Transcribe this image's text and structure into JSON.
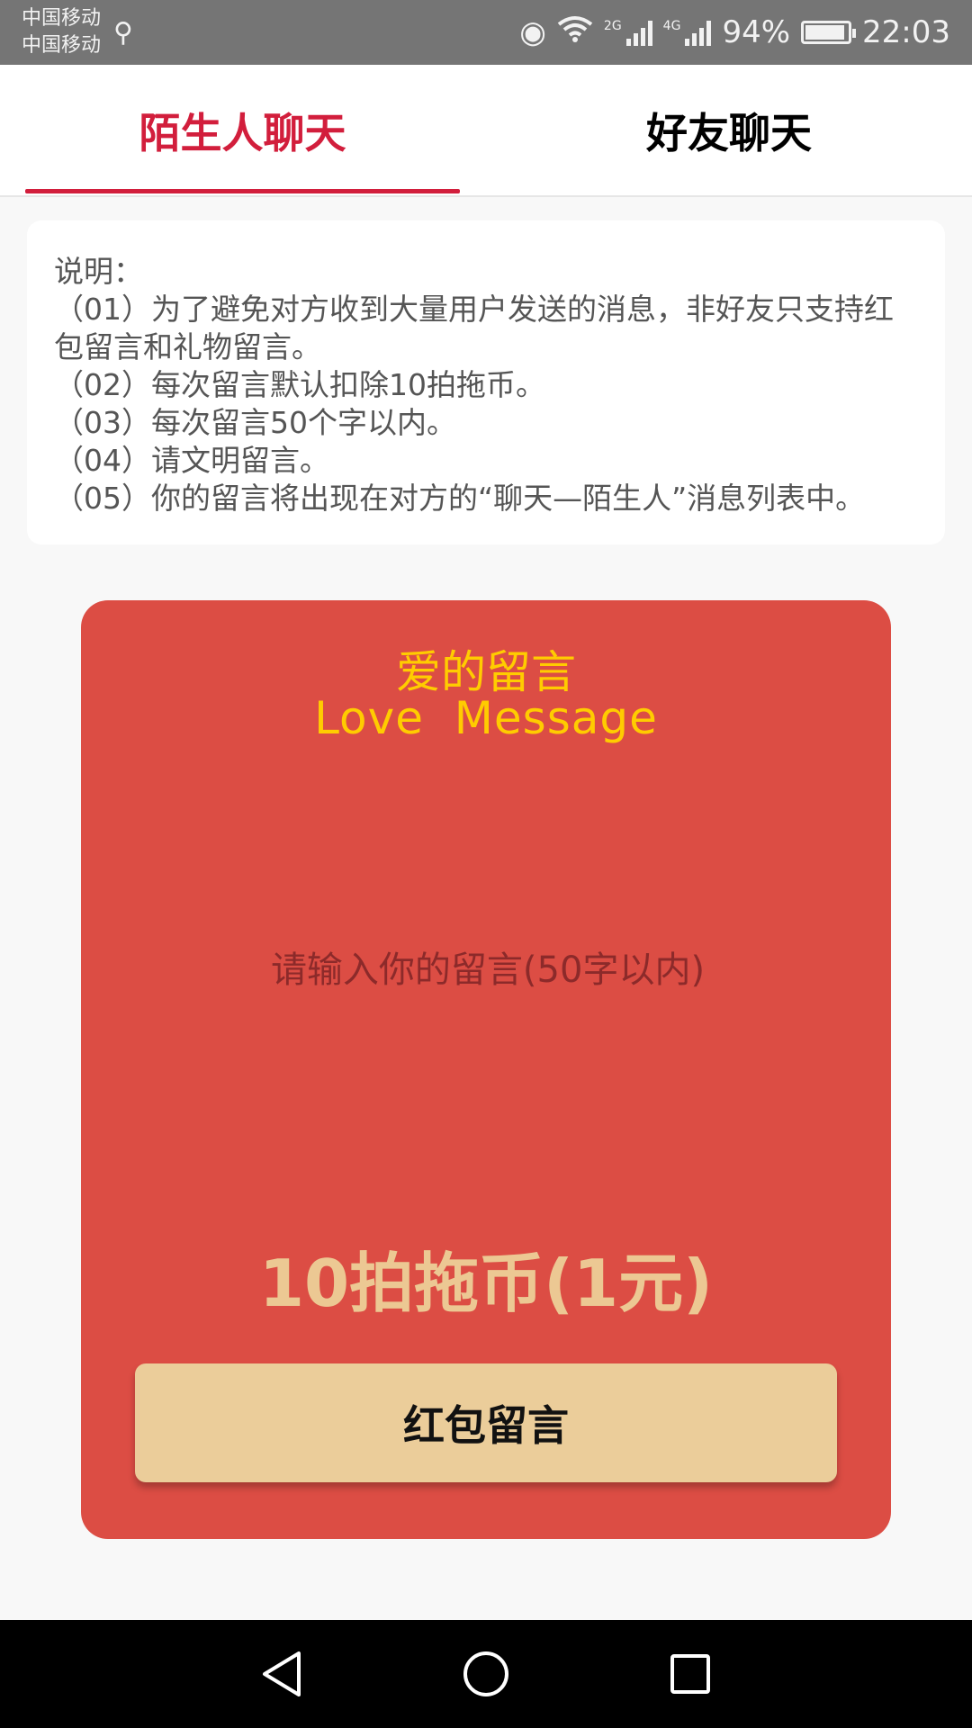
{
  "status_bar": {
    "carrier1": "中国移动",
    "carrier2": "中国移动",
    "usb_icon": "usb-icon",
    "network1": "2G",
    "network2": "4G",
    "battery": "94%",
    "battery_level": 0.94,
    "time": "22:03"
  },
  "tabs": [
    {
      "label": "陌生人聊天",
      "active": true
    },
    {
      "label": "好友聊天",
      "active": false
    }
  ],
  "notice": {
    "title": "说明：",
    "lines": [
      "（01）为了避免对方收到大量用户发送的消息，非好友只支持红包留言和礼物留言。",
      "（02）每次留言默认扣除10拍拖币。",
      "（03）每次留言50个字以内。",
      "（04）请文明留言。",
      "（05）你的留言将出现在对方的“聊天—陌生人”消息列表中。"
    ]
  },
  "card": {
    "title_cn": "爱的留言",
    "title_en": "Love  Message",
    "input_placeholder": "请输入你的留言(50字以内)",
    "input_value": "",
    "price": "10拍拖币(1元)",
    "button_label": "红包留言"
  },
  "colors": {
    "accent": "#d21e3c",
    "card_bg": "#dc4d44",
    "title_yellow": "#ffcc00",
    "gold": "#ebcd9a"
  },
  "nav": {
    "back_icon": "back-triangle-icon",
    "home_icon": "home-circle-icon",
    "recents_icon": "recents-square-icon"
  }
}
